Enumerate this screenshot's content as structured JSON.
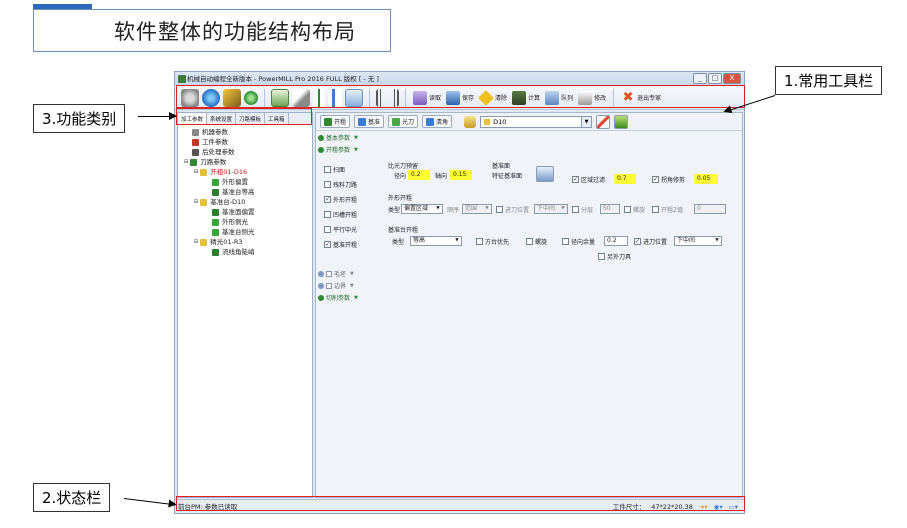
{
  "slide": {
    "title": "软件整体的功能结构布局"
  },
  "callouts": {
    "toolbar": "1.常用工具栏",
    "status": "2.状态栏",
    "category": "3.功能类别"
  },
  "window": {
    "title": "机械自动编程全新版本 - PowerMILL Pro 2016 FULL 版权  [ - 无 ]",
    "min": "_",
    "max": "□",
    "close": "X"
  },
  "toolbar": {
    "load": "读取",
    "save": "保存",
    "clear": "清除",
    "calc": "计算",
    "queue": "队列",
    "modify": "修改",
    "exit": "退出专家"
  },
  "left_tabs": [
    "加工参数",
    "系统设置",
    "刀路模板",
    "工具箱"
  ],
  "tree": [
    {
      "label": "机器参数"
    },
    {
      "label": "工件参数"
    },
    {
      "label": "后处理参数"
    },
    {
      "label": "刀路参数"
    },
    {
      "label": "开粗01-D16"
    },
    {
      "label": "外形偏置"
    },
    {
      "label": "基准台等高"
    },
    {
      "label": "基准台-D10"
    },
    {
      "label": "基准面偏置"
    },
    {
      "label": "外形侧光"
    },
    {
      "label": "基准台侧光"
    },
    {
      "label": "精光01-R3"
    },
    {
      "label": "流线角陡峭"
    }
  ],
  "right_toolbar": {
    "rough": "开粗",
    "base": "基准",
    "light": "光刀",
    "clear_corner": "清角",
    "tool_select": "D10"
  },
  "sections": {
    "basic": "基本参数",
    "rough": "开粗参数",
    "pocket": "毛坯",
    "boundary": "边界",
    "cut": "切削参数"
  },
  "checks": {
    "flat": "扫面",
    "rest": "残料刀路",
    "outline": "外形开粗",
    "pocket": "凹槽开粗",
    "parallel": "平行中光",
    "basestep": "基准开粗"
  },
  "ratio": {
    "title": "比光刀预留",
    "radial_label": "径向",
    "radial_value": "0.2",
    "axial_label": "轴向",
    "axial_value": "0.15"
  },
  "baseplane": {
    "title": "基准面",
    "label": "特征基准面"
  },
  "area_filter": {
    "label": "区域过滤",
    "value": "0.7"
  },
  "corner_fix": {
    "label": "拐角修剪",
    "value": "0.05"
  },
  "outline_rough": {
    "title": "外形开粗",
    "type_label": "类型",
    "type_value": "偏置区域",
    "order_label": "顺序",
    "order_value": "范围",
    "entry_label": "进刀位置",
    "entry_value": "下中间",
    "layer_label": "分层",
    "layer_value": "50",
    "slope_label": "螺旋",
    "sub_label": "开粗Z值",
    "sub_value": "0"
  },
  "base_rough": {
    "title": "基准台开粗",
    "type_label": "类型",
    "type_value": "等高",
    "priority": "方台优先",
    "spiral": "螺旋",
    "radial_label": "径向余量",
    "radial_value": "0.2",
    "entry_label": "进刀位置",
    "entry_value": "下中间",
    "outside_tool": "另外刀具"
  },
  "status": {
    "left": "前台PM: 参数已读取",
    "size_label": "工件尺寸：",
    "size_value": "47*22*20.38"
  },
  "colors": {
    "highlight": "#ffff33",
    "annotation_red": "#dd2222",
    "accent": "#2e68b8"
  }
}
